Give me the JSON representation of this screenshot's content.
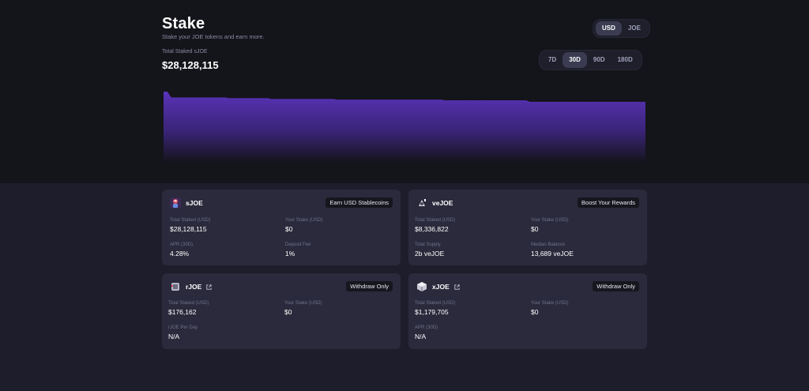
{
  "header": {
    "title": "Stake",
    "subtitle": "Stake your JOE tokens and earn more.",
    "total_label": "Total Staked sJOE",
    "total_value": "$28,128,115"
  },
  "currency_toggle": {
    "options": [
      "USD",
      "JOE"
    ],
    "selected": "USD"
  },
  "range_toggle": {
    "options": [
      "7D",
      "30D",
      "90D",
      "180D"
    ],
    "selected": "30D"
  },
  "chart_data": {
    "type": "area",
    "series": [
      {
        "values": [
          100,
          100,
          92,
          92,
          92,
          92,
          92,
          92,
          92,
          92,
          92,
          92,
          92,
          92,
          92,
          92,
          92,
          91,
          91,
          91,
          91,
          91,
          91,
          91,
          91,
          91,
          91,
          91,
          90,
          90,
          90,
          90,
          90,
          90,
          90,
          90,
          90,
          90,
          90,
          90,
          90,
          90,
          90,
          90,
          90,
          89,
          89,
          89,
          89,
          89,
          89,
          89,
          89,
          89,
          89,
          89,
          89,
          89,
          89,
          89,
          89,
          89,
          89,
          89,
          89,
          89,
          89,
          89,
          89,
          89,
          89,
          89,
          89,
          88,
          88,
          88,
          88,
          88,
          88,
          88,
          88,
          88,
          88,
          88,
          88,
          88,
          88,
          88,
          88,
          88,
          88,
          88,
          88,
          88,
          88,
          86,
          86,
          86,
          86,
          86,
          86,
          86,
          86,
          86,
          86,
          86,
          86,
          86,
          86,
          86,
          86,
          86,
          86,
          86,
          86,
          86,
          86,
          86,
          86,
          86,
          86,
          86,
          86,
          86,
          86,
          86
        ]
      }
    ],
    "colors": {
      "fill_top": "#5a33b8",
      "fill_bottom": "#14141b"
    }
  },
  "cards": [
    {
      "name": "sJOE",
      "badge": "Earn USD Stablecoins",
      "icon": "sjoe-token-icon",
      "stats": [
        {
          "label": "Total Staked (USD)",
          "value": "$28,128,115"
        },
        {
          "label": "Your Stake (USD)",
          "value": "$0"
        },
        {
          "label": "APR (30D)",
          "value": "4.28%"
        },
        {
          "label": "Deposit Fee",
          "value": "1%"
        }
      ]
    },
    {
      "name": "veJOE",
      "badge": "Boost Your Rewards",
      "icon": "vejoe-token-icon",
      "stats": [
        {
          "label": "Total Staked (USD)",
          "value": "$8,336,822"
        },
        {
          "label": "Your Stake (USD)",
          "value": "$0"
        },
        {
          "label": "Total Supply",
          "value": "2b veJOE"
        },
        {
          "label": "Median Balance",
          "value": "13,689 veJOE"
        }
      ]
    },
    {
      "name": "rJOE",
      "badge": "Withdraw Only",
      "icon": "rjoe-token-icon",
      "stats": [
        {
          "label": "Total Staked (USD)",
          "value": "$176,162"
        },
        {
          "label": "Your Stake (USD)",
          "value": "$0"
        },
        {
          "label": "rJOE Per Day",
          "value": "N/A"
        }
      ]
    },
    {
      "name": "xJOE",
      "badge": "Withdraw Only",
      "icon": "xjoe-token-icon",
      "stats": [
        {
          "label": "Total Staked (USD)",
          "value": "$1,179,705"
        },
        {
          "label": "Your Stake (USD)",
          "value": "$0"
        },
        {
          "label": "APR (30D)",
          "value": "N/A"
        }
      ]
    }
  ]
}
